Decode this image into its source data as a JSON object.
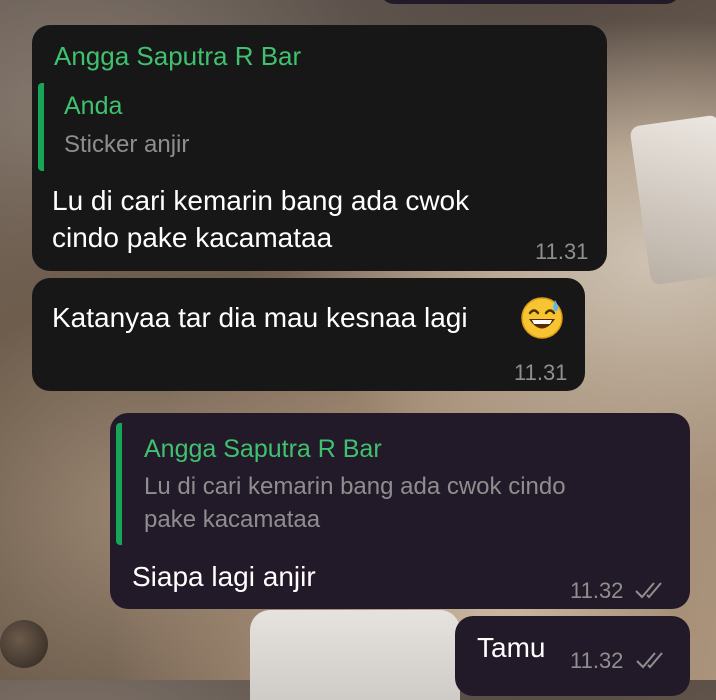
{
  "messages": [
    {
      "sender": "Angga Saputra R Bar",
      "quote_name": "Anda",
      "quote_text": "Sticker anjir",
      "text_line1": "Lu di cari kemarin bang ada cwok",
      "text_line2": "cindo pake kacamataa",
      "time": "11.31"
    },
    {
      "text": "Katanyaa tar dia mau kesnaa lagi",
      "emoji": "grinning-face-with-sweat-icon",
      "time": "11.31"
    },
    {
      "quote_name": "Angga Saputra R Bar",
      "quote_line1": "Lu di cari kemarin bang ada cwok cindo",
      "quote_line2": "pake kacamataa",
      "text": "Siapa lagi anjir",
      "time": "11.32",
      "status_icon": "double-check-icon"
    },
    {
      "text": "Tamu",
      "time": "11.32",
      "status_icon": "double-check-icon"
    }
  ],
  "colors": {
    "incoming_bubble": "#171717",
    "outgoing_bubble": "#221a28",
    "sender_name": "#3fc16f",
    "quote_bar": "#17a558",
    "time_text": "#8f8f8f"
  }
}
